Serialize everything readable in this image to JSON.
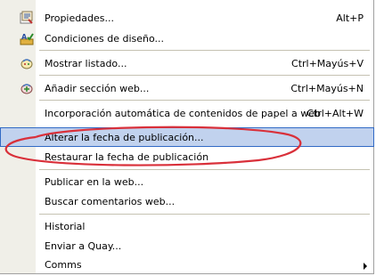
{
  "menu": {
    "items": [
      {
        "label": "Propiedades...",
        "shortcut": "Alt+P",
        "icon": "properties-icon"
      },
      {
        "label": "Condiciones de diseño...",
        "shortcut": "",
        "icon": "design-checker-icon"
      },
      {
        "label": "Mostrar listado...",
        "shortcut": "Ctrl+Mayús+V",
        "icon": "list-icon"
      },
      {
        "label": "Añadir sección web...",
        "shortcut": "Ctrl+Mayús+N",
        "icon": "add-web-section-icon"
      },
      {
        "label": "Incorporación automática de contenidos de papel a web",
        "shortcut": "Ctrl+Alt+W",
        "icon": ""
      },
      {
        "label": "Alterar la fecha de publicación...",
        "shortcut": "",
        "icon": ""
      },
      {
        "label": "Restaurar la fecha de publicación",
        "shortcut": "",
        "icon": ""
      },
      {
        "label": "Publicar en la web...",
        "shortcut": "",
        "icon": ""
      },
      {
        "label": "Buscar comentarios web...",
        "shortcut": "",
        "icon": ""
      },
      {
        "label": "Historial",
        "shortcut": "",
        "icon": ""
      },
      {
        "label": "Enviar a Quay...",
        "shortcut": "",
        "icon": ""
      },
      {
        "label": "Comms",
        "shortcut": "",
        "icon": "submenu-arrow-icon"
      }
    ]
  },
  "colors": {
    "highlight_bg": "#c1d2ee",
    "highlight_border": "#316ac5",
    "annotation_ellipse": "#d9303a"
  }
}
